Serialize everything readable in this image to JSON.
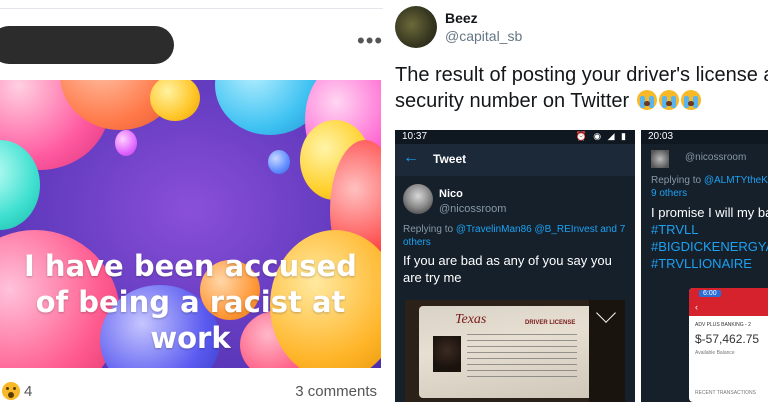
{
  "facebook_post": {
    "caption": "I have been accused of being a racist at work",
    "reaction_count": "4",
    "comments": "3 comments",
    "more_icon": "ellipsis-icon",
    "reaction_icon": "shocked-face-icon"
  },
  "tweet": {
    "author_name": "Beez",
    "author_handle": "@capital_sb",
    "text": "The result of posting your driver's license and social security number on Twitter",
    "emoji_icons": [
      "crying-face-icon",
      "crying-face-icon",
      "crying-face-icon"
    ],
    "screenshot_1": {
      "status_time": "10:37",
      "header_title": "Tweet",
      "author_name": "Nico",
      "author_handle": "@nicossroom",
      "replying_prefix": "Replying to",
      "replying_links": "@TravelinMan86 @B_REInvest and 7",
      "replying_suffix": "others",
      "tweet_text": "If you are bad as any of you say you are try me",
      "license_state": "Texas",
      "license_type": "DRIVER LICENSE"
    },
    "screenshot_2": {
      "status_time": "20:03",
      "author_handle": "@nicossroom",
      "replying_prefix": "Replying to",
      "replying_link": "@ALMTYtheKi",
      "replying_suffix": "9 others",
      "tweet_text": "I promise I will my ba hacked",
      "hashtags": [
        "#TRVLL",
        "#BIGDICKENERGYA",
        "#TRVLLIONAIRE"
      ],
      "bank_time": "6:00",
      "bank_account": "ADV PLUS BANKING - 2",
      "bank_balance": "$-57,462.75",
      "bank_available": "Available Balance",
      "bank_recent": "RECENT TRANSACTIONS"
    }
  },
  "colors": {
    "twitter_blue": "#1da1f2",
    "dark_bg": "#15202b",
    "bank_red": "#d6222d"
  }
}
